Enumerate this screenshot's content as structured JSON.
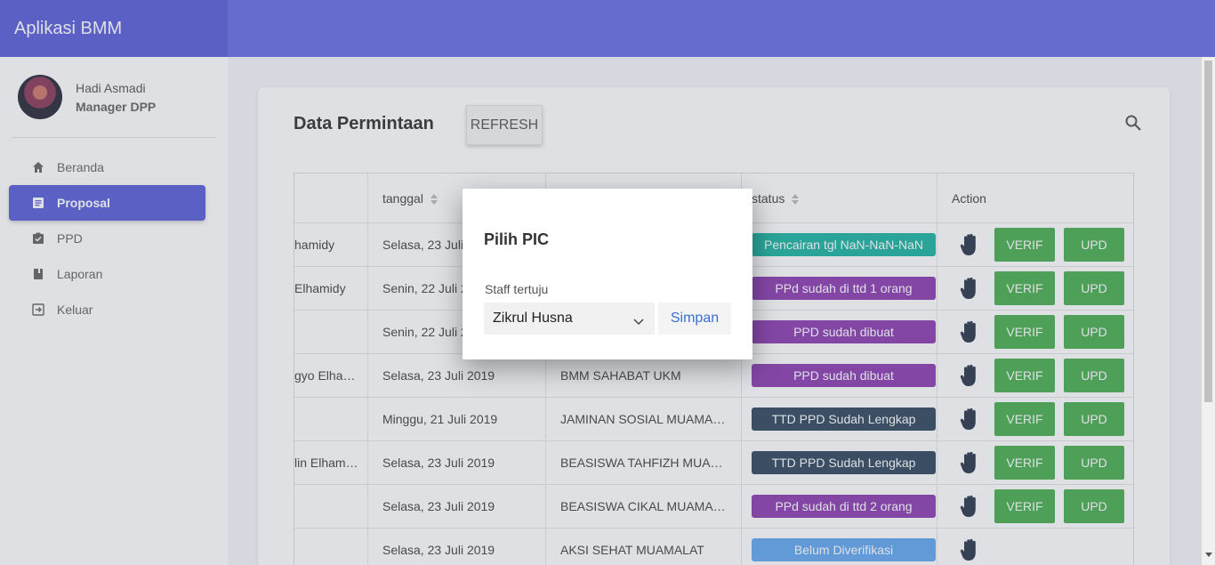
{
  "app": {
    "title": "Aplikasi BMM"
  },
  "profile": {
    "name": "Hadi Asmadi",
    "role": "Manager DPP"
  },
  "sidebar": {
    "items": [
      {
        "label": "Beranda",
        "icon": "home-icon"
      },
      {
        "label": "Proposal",
        "icon": "document-icon",
        "active": true
      },
      {
        "label": "PPD",
        "icon": "clipboard-check-icon"
      },
      {
        "label": "Laporan",
        "icon": "book-icon"
      },
      {
        "label": "Keluar",
        "icon": "exit-icon"
      }
    ]
  },
  "page": {
    "title": "Data Permintaan",
    "refresh_label": "REFRESH"
  },
  "table": {
    "headers": [
      "",
      "tanggal",
      "",
      "status",
      "Action"
    ],
    "rows": [
      {
        "nama": "hamidy",
        "tanggal": "Selasa, 23 Juli",
        "program": "",
        "status": "Pencairan tgl NaN-NaN-NaN",
        "status_color": "#1fb5a1",
        "verif": "VERIF",
        "upd": "UPD"
      },
      {
        "nama": "Elhamidy",
        "tanggal": "Senin, 22 Juli 2",
        "program": "",
        "status": "PPd sudah di ttd 1 orang",
        "status_color": "#8e3fb0",
        "verif": "VERIF",
        "upd": "UPD"
      },
      {
        "nama": "",
        "tanggal": "Senin, 22 Juli 2",
        "program": "",
        "status": "PPD sudah dibuat",
        "status_color": "#8e3fb0",
        "verif": "VERIF",
        "upd": "UPD"
      },
      {
        "nama": "gyo Elha…",
        "tanggal": "Selasa, 23 Juli 2019",
        "program": "BMM SAHABAT UKM",
        "status": "PPD sudah dibuat",
        "status_color": "#8e3fb0",
        "verif": "VERIF",
        "upd": "UPD"
      },
      {
        "nama": "",
        "tanggal": "Minggu, 21 Juli 2019",
        "program": "JAMINAN SOSIAL MUAMAL…",
        "status": "TTD PPD Sudah Lengkap",
        "status_color": "#34495e",
        "verif": "VERIF",
        "upd": "UPD"
      },
      {
        "nama": "lin Elham…",
        "tanggal": "Selasa, 23 Juli 2019",
        "program": "BEASISWA TAHFIZH MUAM…",
        "status": "TTD PPD Sudah Lengkap",
        "status_color": "#34495e",
        "verif": "VERIF",
        "upd": "UPD"
      },
      {
        "nama": "",
        "tanggal": "Selasa, 23 Juli 2019",
        "program": "BEASISWA CIKAL MUAMAL…",
        "status": "PPd sudah di ttd 2 orang",
        "status_color": "#8e3fb0",
        "verif": "VERIF",
        "upd": "UPD"
      },
      {
        "nama": "",
        "tanggal": "Selasa, 23 Juli 2019",
        "program": "AKSI SEHAT MUAMALAT",
        "status": "Belum Diverifikasi",
        "status_color": "#64a8f0",
        "verif": "",
        "upd": ""
      }
    ]
  },
  "dialog": {
    "title": "Pilih PIC",
    "field_label": "Staff tertuju",
    "selected": "Zikrul Husna",
    "save_label": "Simpan"
  },
  "colors": {
    "primary": "#5c61d8",
    "accent_green": "#4caf50",
    "link_blue": "#3a6fd1"
  }
}
